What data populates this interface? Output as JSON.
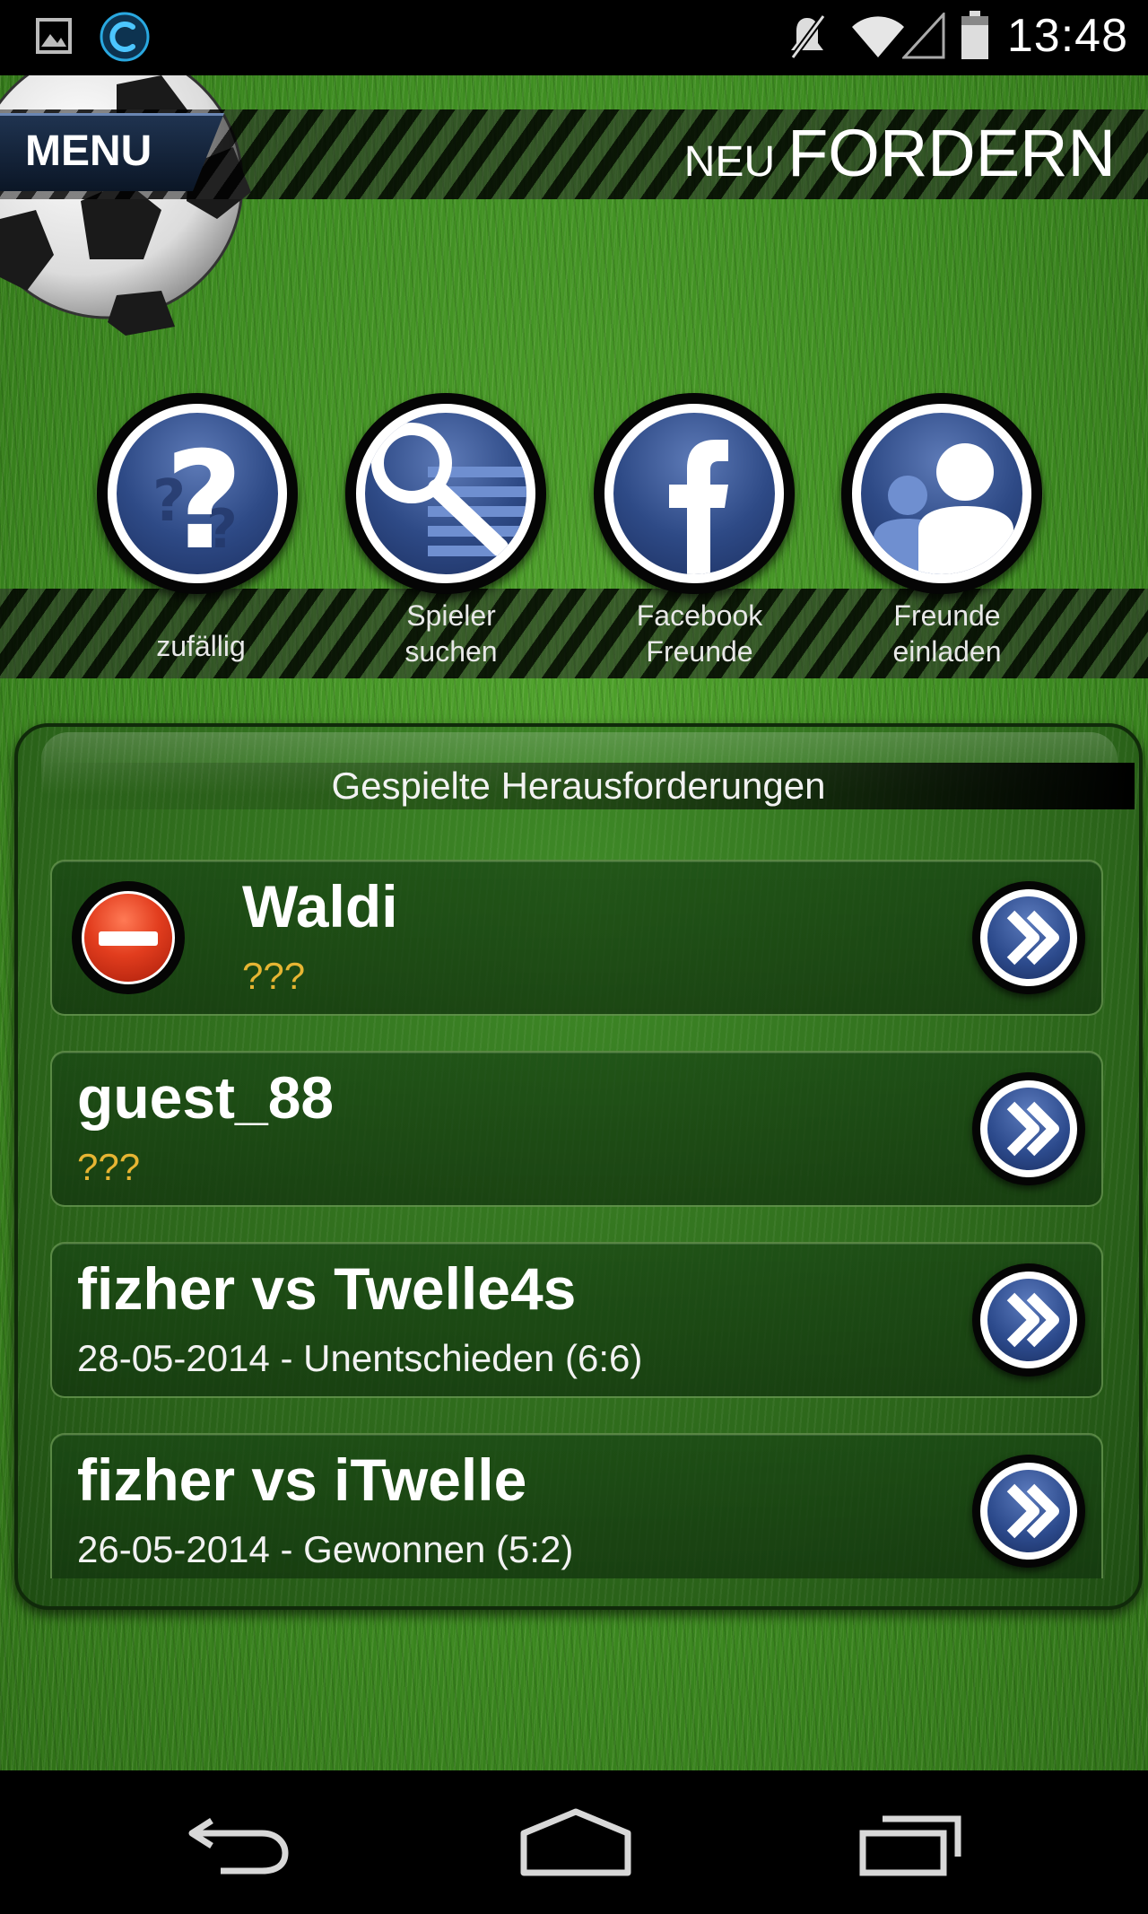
{
  "status_bar": {
    "time": "13:48",
    "left_icons": [
      "image-icon",
      "app-c-icon"
    ],
    "right_icons": [
      "mute-icon",
      "wifi-icon",
      "signal-icon",
      "battery-icon"
    ]
  },
  "header": {
    "menu_label": "MENU",
    "title_small": "NEU",
    "title_big": "FORDERN"
  },
  "actions": [
    {
      "label": "zufällig",
      "icon": "question-icon"
    },
    {
      "label": "Spieler\nsuchen",
      "icon": "search-list-icon"
    },
    {
      "label": "Facebook\nFreunde",
      "icon": "facebook-icon"
    },
    {
      "label": "Freunde\neinladen",
      "icon": "friends-icon"
    }
  ],
  "panel": {
    "title": "Gespielte Herausforderungen",
    "rows": [
      {
        "title": "Waldi",
        "subtitle": "???",
        "has_remove": true
      },
      {
        "title": "guest_88",
        "subtitle": "???",
        "has_remove": false
      },
      {
        "title": "fizher vs Twelle4s",
        "subtitle": "28-05-2014 - Unentschieden (6:6)",
        "has_remove": false
      },
      {
        "title": "fizher vs iTwelle",
        "subtitle": "26-05-2014 - Gewonnen (5:2)",
        "has_remove": false
      }
    ]
  },
  "colors": {
    "grass": "#3f8e22",
    "button_blue": "#2e4a86",
    "subtitle_yellow": "#e6b533",
    "remove_red": "#e23d1e"
  },
  "nav_bar": [
    "back-icon",
    "home-icon",
    "recents-icon"
  ]
}
